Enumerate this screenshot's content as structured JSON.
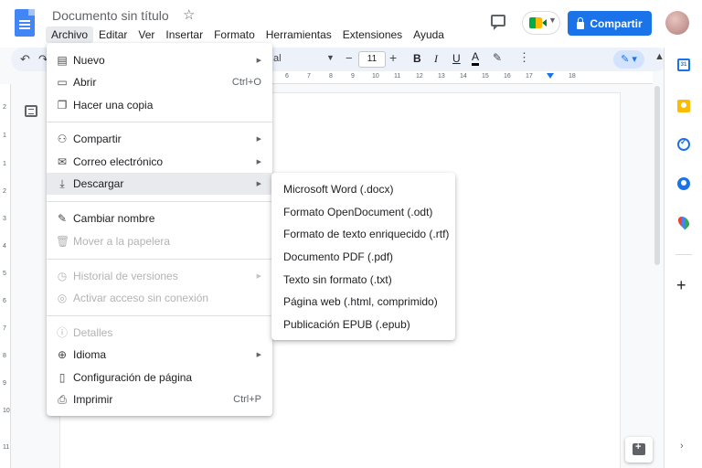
{
  "header": {
    "doc_title": "Documento sin título",
    "share_label": "Compartir",
    "menubar": [
      "Archivo",
      "Editar",
      "Ver",
      "Insertar",
      "Formato",
      "Herramientas",
      "Extensiones",
      "Ayuda"
    ]
  },
  "toolbar": {
    "font_fragment": "al",
    "font_size": "11",
    "bold": "B",
    "italic": "I",
    "underline": "U",
    "text_color": "A",
    "more": "⋮"
  },
  "ruler": {
    "horizontal": [
      "6",
      "7",
      "8",
      "9",
      "10",
      "11",
      "12",
      "13",
      "14",
      "15",
      "16",
      "17",
      "18"
    ],
    "vertical": [
      "2",
      "1",
      "1",
      "2",
      "3",
      "4",
      "5",
      "6",
      "7",
      "8",
      "9",
      "10",
      "11"
    ]
  },
  "file_menu": {
    "items": [
      {
        "label": "Nuevo",
        "icon": "doc-icon"
      },
      {
        "label": "Abrir",
        "icon": "folder-icon",
        "shortcut": "Ctrl+O"
      },
      {
        "label": "Hacer una copia",
        "icon": "copy-icon"
      },
      {
        "label": "Compartir",
        "icon": "person-add-icon"
      },
      {
        "label": "Correo electrónico",
        "icon": "mail-icon"
      },
      {
        "label": "Descargar",
        "icon": "download-icon"
      },
      {
        "label": "Cambiar nombre",
        "icon": "rename-icon"
      },
      {
        "label": "Mover a la papelera",
        "icon": "trash-icon"
      },
      {
        "label": "Historial de versiones",
        "icon": "history-icon"
      },
      {
        "label": "Activar acceso sin conexión",
        "icon": "offline-icon"
      },
      {
        "label": "Detalles",
        "icon": "info-icon"
      },
      {
        "label": "Idioma",
        "icon": "globe-icon"
      },
      {
        "label": "Configuración de página",
        "icon": "page-setup-icon"
      },
      {
        "label": "Imprimir",
        "icon": "print-icon",
        "shortcut": "Ctrl+P"
      }
    ]
  },
  "download_menu": {
    "items": [
      "Microsoft Word (.docx)",
      "Formato OpenDocument (.odt)",
      "Formato de texto enriquecido (.rtf)",
      "Documento PDF (.pdf)",
      "Texto sin formato (.txt)",
      "Página web (.html, comprimido)",
      "Publicación EPUB (.epub)"
    ]
  },
  "side_panel": {
    "calendar_day": "31"
  },
  "colors": {
    "accent": "#1a73e8",
    "menu_hover": "#e8eaed",
    "disabled_text": "#b3b3b3"
  }
}
